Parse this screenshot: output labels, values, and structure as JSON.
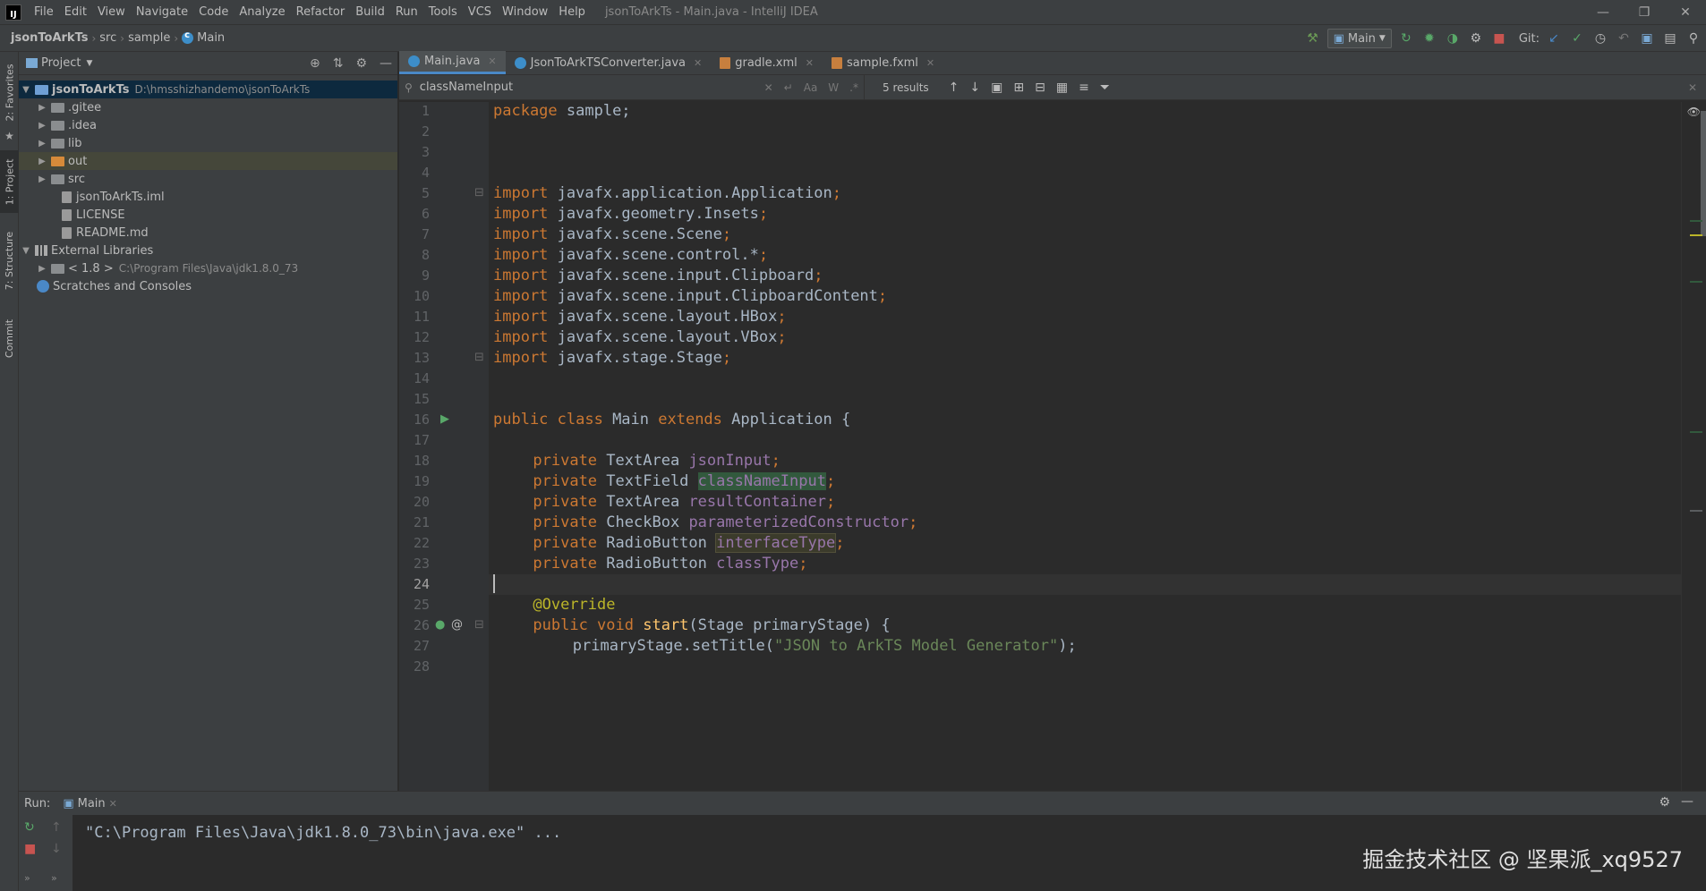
{
  "app": {
    "window_title": "jsonToArkTs - Main.java - IntelliJ IDEA",
    "logo_text": "IJ",
    "menu": [
      "File",
      "Edit",
      "View",
      "Navigate",
      "Code",
      "Analyze",
      "Refactor",
      "Build",
      "Run",
      "Tools",
      "VCS",
      "Window",
      "Help"
    ]
  },
  "breadcrumb": [
    "jsonToArkTs",
    "src",
    "sample",
    "Main"
  ],
  "toolbar": {
    "run_config": "Main",
    "git_label": "Git:"
  },
  "left_strip": {
    "tabs": [
      "2: Favorites",
      "1: Project",
      "7: Structure",
      "Commit"
    ]
  },
  "project": {
    "title": "Project",
    "root": {
      "name": "jsonToArkTs",
      "path": "D:\\hmsshizhandemo\\jsonToArkTs"
    },
    "folders": [
      ".gitee",
      ".idea",
      "lib",
      "out",
      "src"
    ],
    "files": [
      "jsonToArkTs.iml",
      "LICENSE",
      "README.md"
    ],
    "external_libraries": "External Libraries",
    "jdk": {
      "name": "< 1.8 >",
      "path": "C:\\Program Files\\Java\\jdk1.8.0_73"
    },
    "scratches": "Scratches and Consoles"
  },
  "editor": {
    "tabs": [
      {
        "label": "Main.java",
        "type": "java",
        "active": true
      },
      {
        "label": "JsonToArkTSConverter.java",
        "type": "java",
        "active": false
      },
      {
        "label": "gradle.xml",
        "type": "xml",
        "active": false
      },
      {
        "label": "sample.fxml",
        "type": "xml",
        "active": false
      }
    ],
    "find": {
      "query": "classNameInput",
      "opts": [
        "Aa",
        "W",
        ".*"
      ],
      "results": "5 results"
    },
    "current_line": 24,
    "visible_line_numbers": [
      "1",
      "2",
      "3",
      "4",
      "5",
      "6",
      "7",
      "8",
      "9",
      "10",
      "11",
      "12",
      "13",
      "14",
      "15",
      "16",
      "17",
      "18",
      "19",
      "20",
      "21",
      "22",
      "23",
      "24",
      "25",
      "26",
      "27",
      "28"
    ],
    "code": {
      "l1": {
        "kw": "package",
        "rest": " sample;"
      },
      "imports": [
        "javafx.application.Application",
        "javafx.geometry.Insets",
        "javafx.scene.Scene",
        "javafx.scene.control.*",
        "javafx.scene.input.Clipboard",
        "javafx.scene.input.ClipboardContent",
        "javafx.scene.layout.HBox",
        "javafx.scene.layout.VBox",
        "javafx.stage.Stage"
      ],
      "import_kw": "import",
      "class_decl": {
        "kw1": "public class",
        "name": " Main ",
        "kw2": "extends",
        "rest": " Application {"
      },
      "fields": [
        {
          "type": "TextArea",
          "name": "jsonInput",
          "hl": ""
        },
        {
          "type": "TextField",
          "name": "classNameInput",
          "hl": "green"
        },
        {
          "type": "TextArea",
          "name": "resultContainer",
          "hl": ""
        },
        {
          "type": "CheckBox",
          "name": "parameterizedConstructor",
          "hl": ""
        },
        {
          "type": "RadioButton",
          "name": "interfaceType",
          "hl": "olive"
        },
        {
          "type": "RadioButton",
          "name": "classType",
          "hl": ""
        }
      ],
      "private_kw": "private",
      "annotation": "@Override",
      "method_decl": {
        "kw": "public void",
        "name": "start",
        "rest": "(Stage primaryStage) {"
      },
      "settitle": {
        "pre": "primaryStage.setTitle(",
        "str": "\"JSON to ArkTS Model Generator\"",
        "post": ");"
      }
    }
  },
  "run": {
    "label": "Run:",
    "tab": "Main",
    "output": "\"C:\\Program Files\\Java\\jdk1.8.0_73\\bin\\java.exe\" ..."
  },
  "watermark": "掘金技术社区 @ 坚果派_xq9527",
  "colors": {
    "keyword": "#cc7832",
    "field": "#9876aa",
    "string": "#6a8759",
    "annotation": "#bbb529",
    "method": "#ffc66d",
    "accent": "#4a88c7"
  }
}
